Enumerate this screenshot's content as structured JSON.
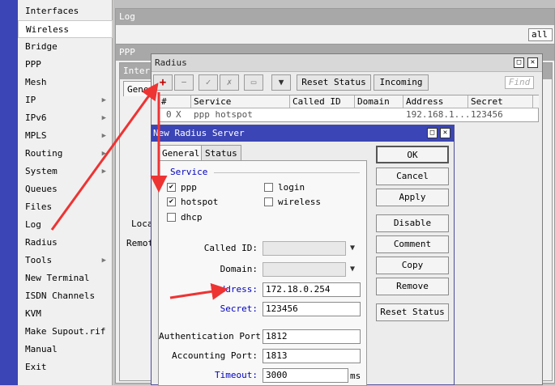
{
  "menu": {
    "items": [
      {
        "label": "Interfaces",
        "submenu": false
      },
      {
        "label": "Wireless",
        "submenu": false
      },
      {
        "label": "Bridge",
        "submenu": false
      },
      {
        "label": "PPP",
        "submenu": false
      },
      {
        "label": "Mesh",
        "submenu": false
      },
      {
        "label": "IP",
        "submenu": true
      },
      {
        "label": "IPv6",
        "submenu": true
      },
      {
        "label": "MPLS",
        "submenu": true
      },
      {
        "label": "Routing",
        "submenu": true
      },
      {
        "label": "System",
        "submenu": true
      },
      {
        "label": "Queues",
        "submenu": false
      },
      {
        "label": "Files",
        "submenu": false
      },
      {
        "label": "Log",
        "submenu": false
      },
      {
        "label": "Radius",
        "submenu": false
      },
      {
        "label": "Tools",
        "submenu": true
      },
      {
        "label": "New Terminal",
        "submenu": false
      },
      {
        "label": "ISDN Channels",
        "submenu": false
      },
      {
        "label": "KVM",
        "submenu": false
      },
      {
        "label": "Make Supout.rif",
        "submenu": false
      },
      {
        "label": "Manual",
        "submenu": false
      },
      {
        "label": "Exit",
        "submenu": false
      }
    ],
    "submenu_arrow": "▶"
  },
  "background": {
    "log_title": "Log",
    "log_filter": "all",
    "ppp_title": "PPP",
    "inter_title": "Inter",
    "gener_tab": "Gener",
    "loca_label": "Loca",
    "remot_label": "Remot"
  },
  "radius": {
    "title": "Radius",
    "reset_status": "Reset Status",
    "incoming": "Incoming",
    "find_placeholder": "Find",
    "columns": [
      "#",
      "Service",
      "Called ID",
      "Domain",
      "Address",
      "Secret"
    ],
    "rows": [
      {
        "num": "0",
        "flag": "X",
        "service": "ppp hotspot",
        "called_id": "",
        "domain": "",
        "address": "192.168.1...",
        "secret": "123456"
      }
    ]
  },
  "dialog": {
    "title": "New Radius Server",
    "tabs": [
      "General",
      "Status"
    ],
    "service_label": "Service",
    "services": [
      {
        "label": "ppp",
        "checked": true
      },
      {
        "label": "login",
        "checked": false
      },
      {
        "label": "hotspot",
        "checked": true
      },
      {
        "label": "wireless",
        "checked": false
      },
      {
        "label": "dhcp",
        "checked": false
      }
    ],
    "check_mark": "✔",
    "fields": {
      "called_id": {
        "label": "Called ID:",
        "value": ""
      },
      "domain": {
        "label": "Domain:",
        "value": ""
      },
      "address": {
        "label": "Address:",
        "value": "172.18.0.254"
      },
      "secret": {
        "label": "Secret:",
        "value": "123456"
      },
      "auth_port": {
        "label": "Authentication Port:",
        "value": "1812"
      },
      "acct_port": {
        "label": "Accounting Port:",
        "value": "1813"
      },
      "timeout": {
        "label": "Timeout:",
        "value": "3000",
        "unit": "ms"
      }
    },
    "buttons": [
      "OK",
      "Cancel",
      "Apply",
      "Disable",
      "Comment",
      "Copy",
      "Remove",
      "Reset Status"
    ]
  },
  "colors": {
    "annotation_arrow": "#ee3333",
    "title_bar": "#3b45b5"
  }
}
